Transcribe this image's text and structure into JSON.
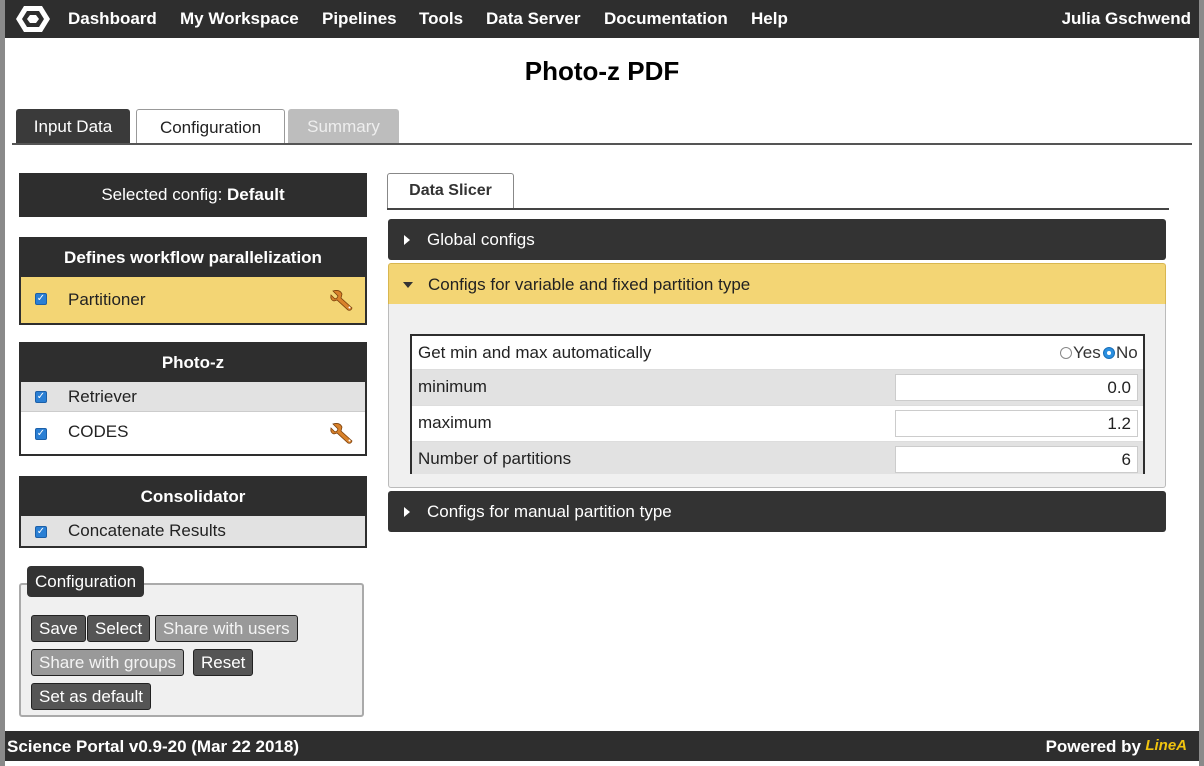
{
  "nav": {
    "items": [
      "Dashboard",
      "My Workspace",
      "Pipelines",
      "Tools",
      "Data Server",
      "Documentation",
      "Help"
    ],
    "user": "Julia Gschwend"
  },
  "page": {
    "title": "Photo-z PDF"
  },
  "tabs": {
    "input": "Input Data",
    "configuration": "Configuration",
    "summary": "Summary"
  },
  "left": {
    "selected_prefix": "Selected config:",
    "selected_value": "Default",
    "groups": [
      {
        "title": "Defines workflow parallelization",
        "items": [
          {
            "label": "Partitioner",
            "checked": true,
            "configurable": true
          }
        ]
      },
      {
        "title": "Photo-z",
        "items": [
          {
            "label": "Retriever",
            "checked": true,
            "configurable": false
          },
          {
            "label": "CODES",
            "checked": true,
            "configurable": true
          }
        ]
      },
      {
        "title": "Consolidator",
        "items": [
          {
            "label": "Concatenate Results",
            "checked": true,
            "configurable": false
          }
        ]
      }
    ],
    "config_box": {
      "legend": "Configuration",
      "buttons": {
        "save": "Save",
        "select": "Select",
        "share_users": "Share with users",
        "share_groups": "Share with groups",
        "reset": "Reset",
        "set_default": "Set as default"
      }
    }
  },
  "right": {
    "subtab": "Data Slicer",
    "accordions": {
      "global": "Global configs",
      "variable": "Configs for variable and fixed partition type",
      "manual": "Configs for manual partition type"
    },
    "fields": {
      "auto_label": "Get min and max automatically",
      "yes": "Yes",
      "no": "No",
      "selected": "No",
      "minimum_label": "minimum",
      "minimum_value": "0.0",
      "maximum_label": "maximum",
      "maximum_value": "1.2",
      "partitions_label": "Number of partitions",
      "partitions_value": "6"
    }
  },
  "footer": {
    "version": "Science Portal v0.9-20 (Mar 22 2018)",
    "powered": "Powered by",
    "brand": "LineA"
  },
  "colors": {
    "dark": "#2e2e2e",
    "highlight": "#f3d574",
    "accent": "#2a7fd4"
  }
}
